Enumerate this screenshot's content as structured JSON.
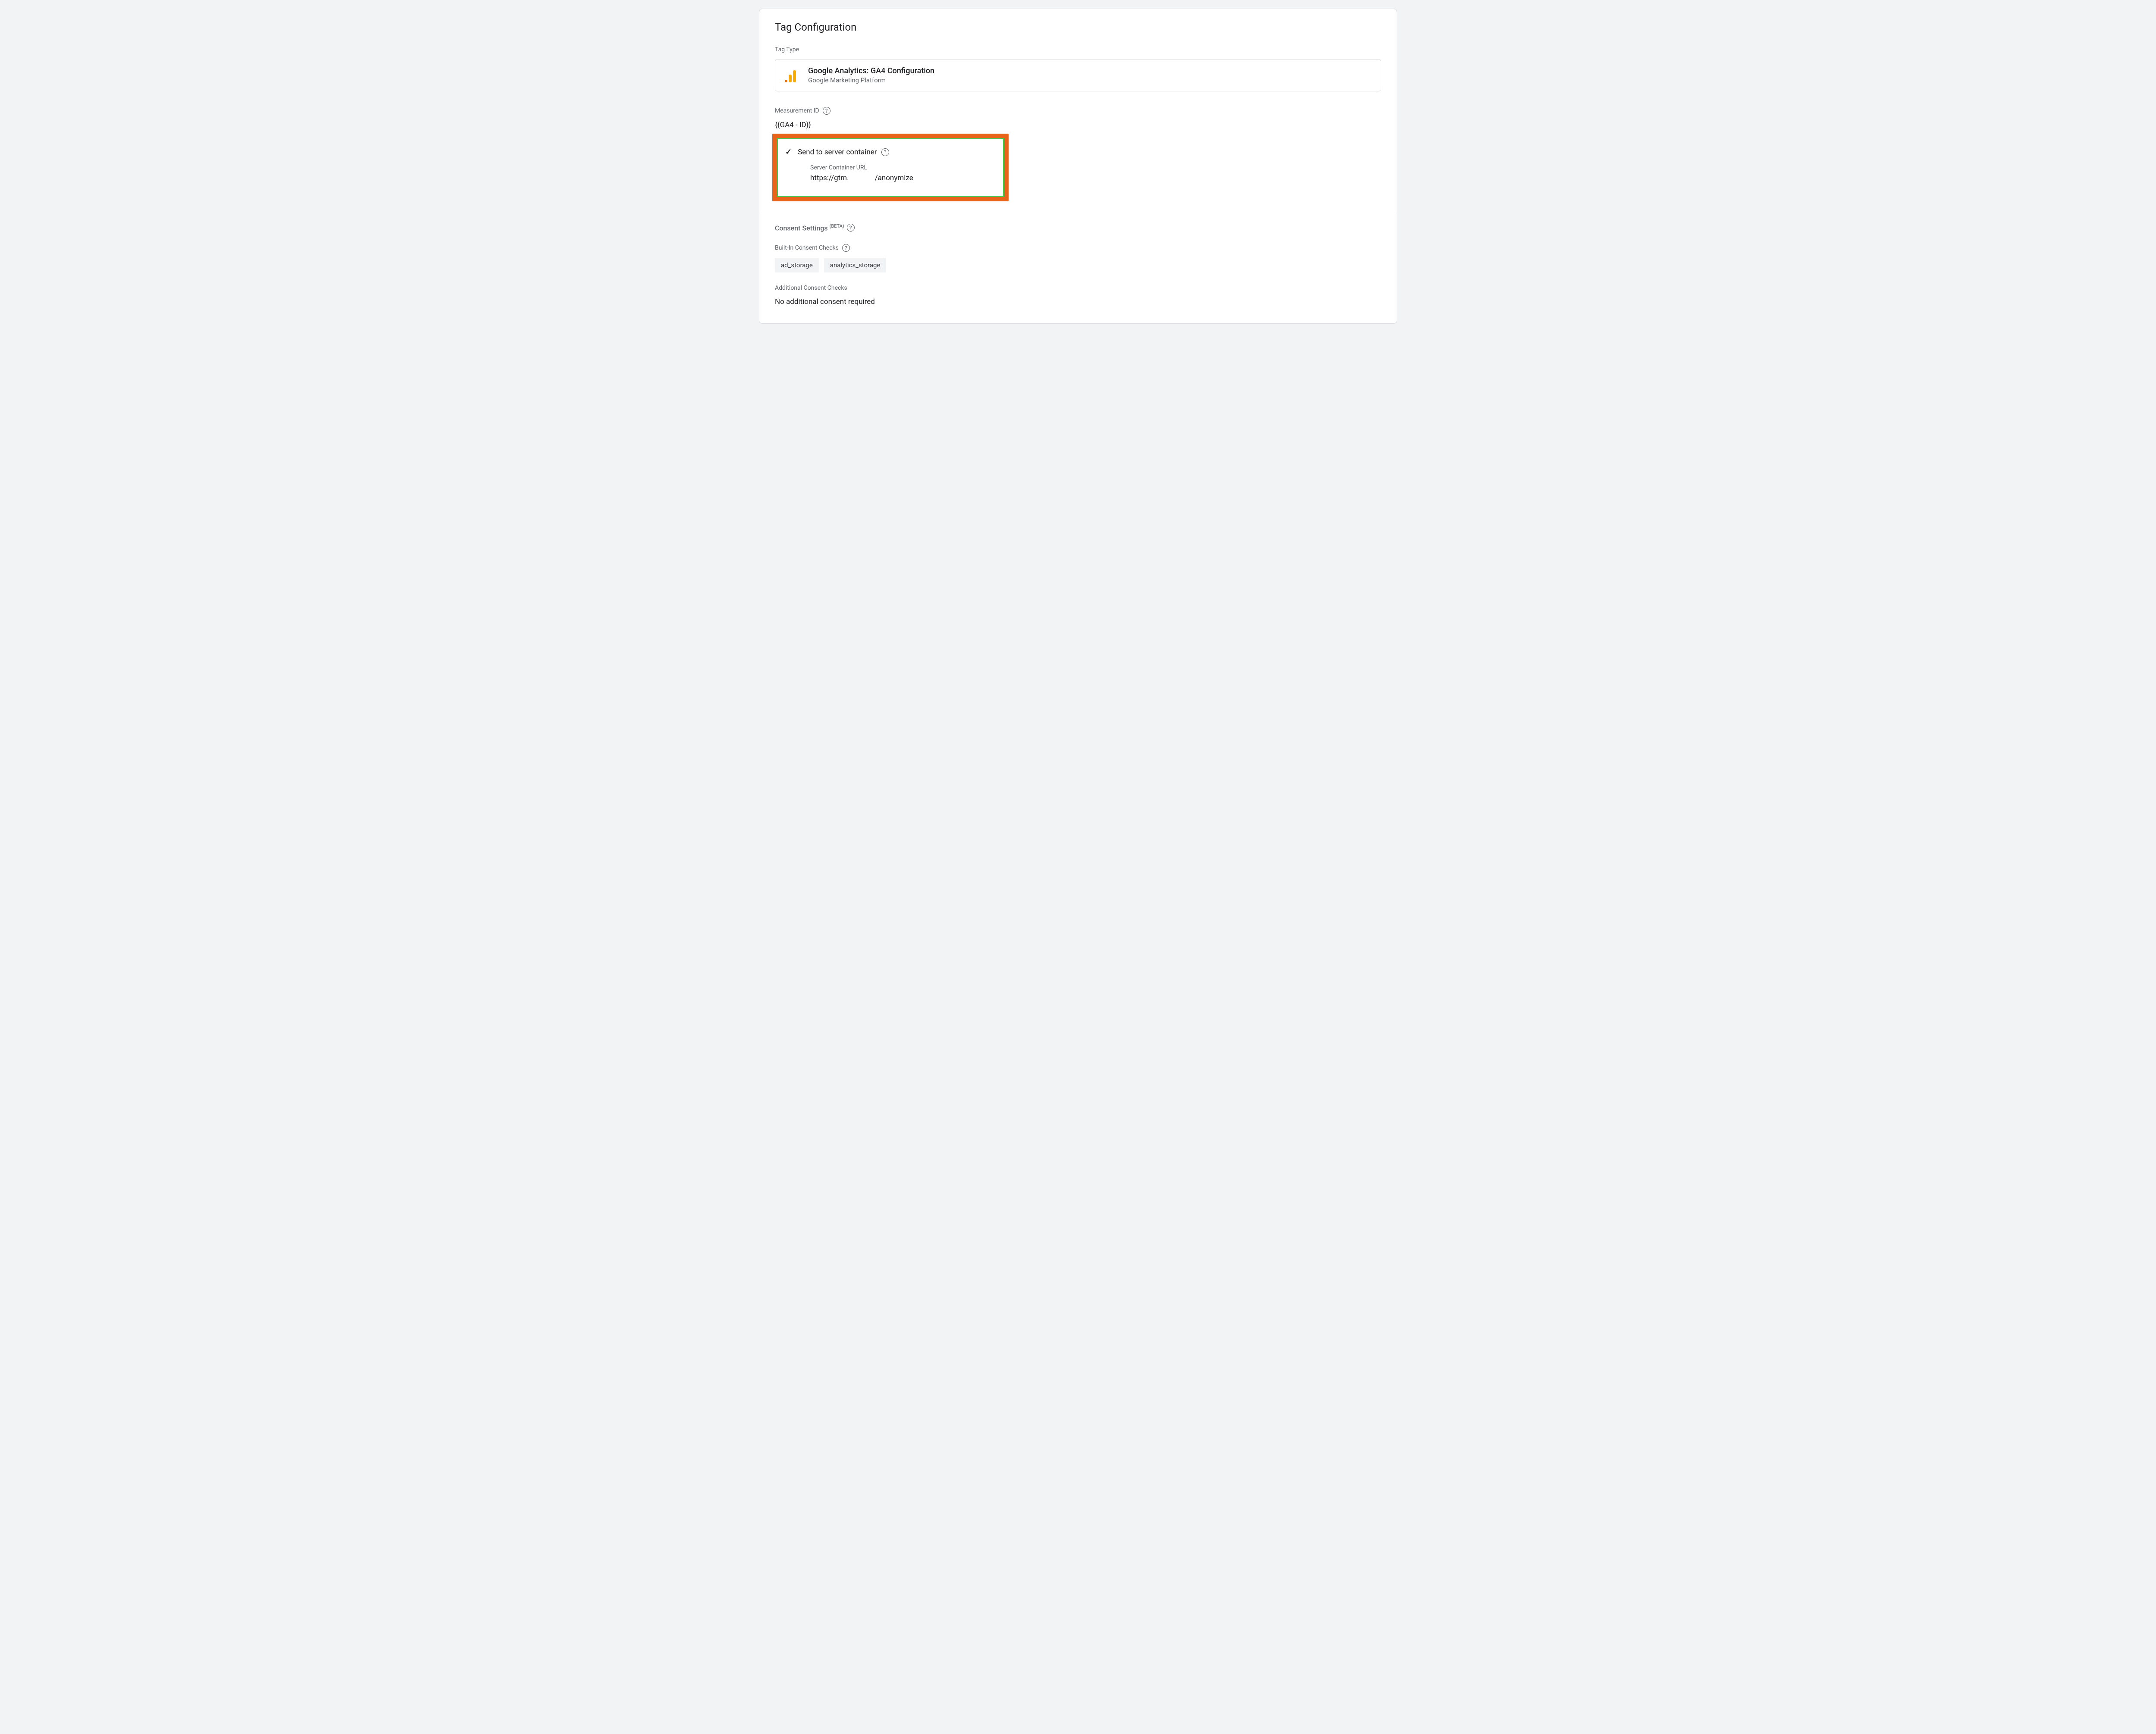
{
  "header": {
    "title": "Tag Configuration",
    "tag_type_label": "Tag Type"
  },
  "tag_type": {
    "title": "Google Analytics: GA4 Configuration",
    "subtitle": "Google Marketing Platform"
  },
  "measurement_id": {
    "label": "Measurement ID",
    "value": "{{GA4 - ID}}"
  },
  "server_container": {
    "checkbox_label": "Send to server container",
    "url_label": "Server Container URL",
    "url_part1": "https://gtm.",
    "url_part2": "/anonymize"
  },
  "consent": {
    "title": "Consent Settings",
    "beta": "(BETA)",
    "builtin_label": "Built-In Consent Checks",
    "builtin_chips": [
      "ad_storage",
      "analytics_storage"
    ],
    "additional_label": "Additional Consent Checks",
    "additional_value": "No additional consent required"
  }
}
